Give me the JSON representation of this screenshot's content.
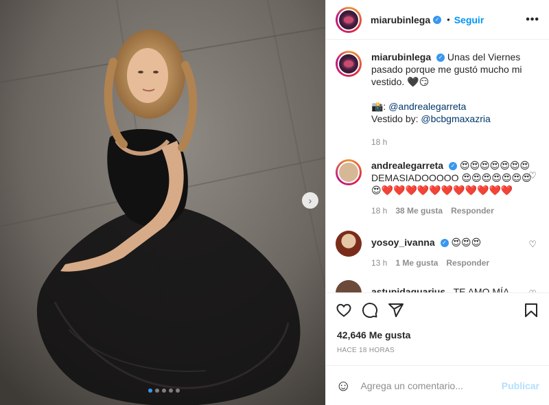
{
  "post": {
    "username": "miarubinlega",
    "follow_label": "Seguir",
    "bullet": "•",
    "more_label": "•••",
    "next_arrow": "›",
    "carousel_total": 5,
    "carousel_active": 1
  },
  "caption": {
    "username": "miarubinlega",
    "text": "Unas del Viernes pasado porque me gustó mucho mi vestido. 🖤😏",
    "credit_prefix": "📸: ",
    "credit_mention": "@andrealegarreta",
    "dress_prefix": "Vestido by: ",
    "dress_mention": "@bcbgmaxazria",
    "time": "18 h"
  },
  "comments": [
    {
      "username": "andrealegarreta",
      "text": "😍😍😍😍😍😍😍 DEMASIADOOOOO 😍😍😍😍😍😍😍😍❤️❤️❤️❤️❤️❤️❤️❤️❤️❤️❤️",
      "time": "18 h",
      "likes": "38 Me gusta",
      "reply": "Responder"
    },
    {
      "username": "yosoy_ivanna",
      "text": "😍😍😍",
      "time": "13 h",
      "likes": "1 Me gusta",
      "reply": "Responder"
    },
    {
      "username": "astupidaquarius_",
      "text": "TE AMO MÍA"
    }
  ],
  "stats": {
    "likes": "42,646 Me gusta",
    "ago": "HACE 18 HORAS"
  },
  "add_comment": {
    "placeholder": "Agrega un comentario...",
    "publish": "Publicar"
  },
  "icons": {
    "like": "heart-icon",
    "comment": "comment-icon",
    "share": "share-icon",
    "save": "bookmark-icon",
    "emoji": "emoji-icon",
    "verified": "verified-badge-icon"
  },
  "colors": {
    "link_blue": "#0095f6",
    "mention": "#00376b",
    "verified": "#3897f0",
    "muted": "#8e8e8e",
    "publish_disabled": "#b2dffc"
  }
}
